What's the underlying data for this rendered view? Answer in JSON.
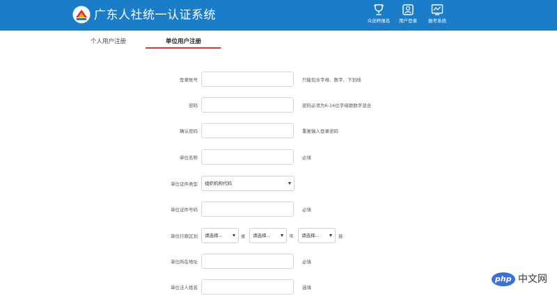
{
  "header": {
    "brand": "广东人社统一认证系统",
    "nav": [
      {
        "label": "众创杯报名",
        "icon": "cup-icon"
      },
      {
        "label": "用户登录",
        "icon": "user-card-icon"
      },
      {
        "label": "报考系统",
        "icon": "exam-screen-icon"
      }
    ],
    "colors": {
      "header_bg": "#1b7cc8",
      "tab_accent": "#e5303a"
    }
  },
  "tabs": {
    "personal": "个人用户注册",
    "unit": "单位用户注册",
    "active": "unit"
  },
  "form": {
    "account": {
      "label": "登录账号",
      "value": "",
      "hint": "只能包含字母、数字、下划线"
    },
    "password": {
      "label": "密码",
      "value": "",
      "hint": "密码必须为6-16位字母跟数字混合"
    },
    "confirm_password": {
      "label": "确认密码",
      "value": "",
      "hint": "重复输入登录密码"
    },
    "unit_name": {
      "label": "单位名称",
      "value": "",
      "hint": "必填"
    },
    "cert_type": {
      "label": "单位证件类型",
      "selected": "组织机构代码"
    },
    "cert_number": {
      "label": "单位证件号码",
      "value": "",
      "hint": "必填"
    },
    "region": {
      "label": "单位行政区划",
      "province": "请选择...",
      "province_unit": "省",
      "city": "请选择...",
      "city_unit": "市",
      "county": "请选择...",
      "county_unit": "县"
    },
    "address": {
      "label": "单位所在地址",
      "value": "",
      "hint": "必填"
    },
    "legal_person": {
      "label": "单位法人姓名",
      "value": "",
      "hint": "选填"
    }
  },
  "watermark": {
    "php": "php",
    "site": "中文网"
  }
}
